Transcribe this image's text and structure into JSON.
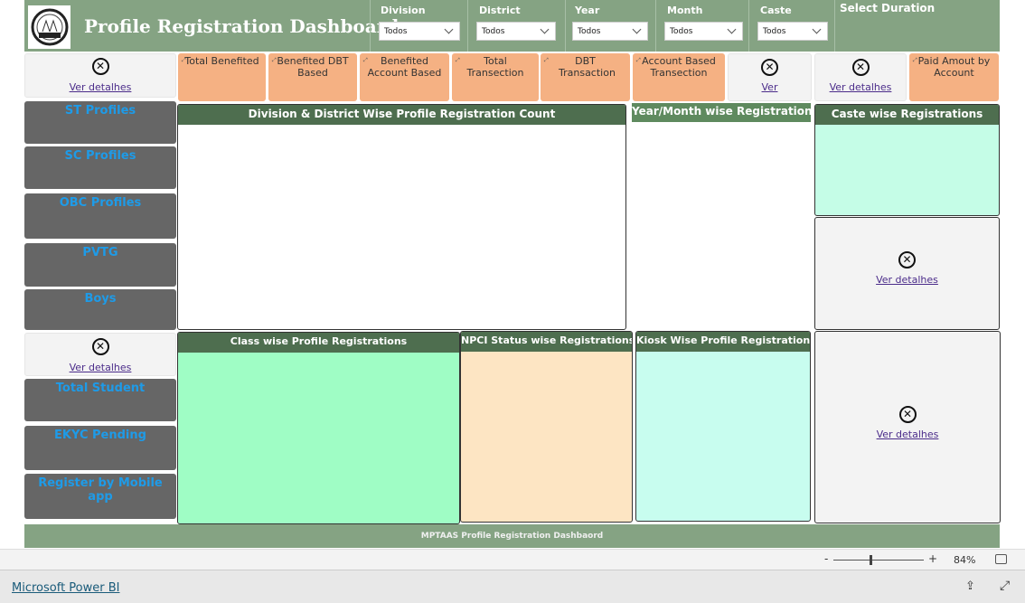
{
  "header": {
    "title": "Profile Registration Dashboard",
    "logo_text": "MPTAAS",
    "select_duration": "Select Duration"
  },
  "filters": [
    {
      "label": "Division",
      "value": "Todos"
    },
    {
      "label": "District",
      "value": "Todos"
    },
    {
      "label": "Year",
      "value": "Todos"
    },
    {
      "label": "Month",
      "value": "Todos"
    },
    {
      "label": "Caste",
      "value": "Todos"
    }
  ],
  "kpis": [
    "Total Benefited",
    "Benefited DBT Based",
    "Benefited Account Based",
    "Total Transection",
    "DBT Transaction",
    "Account Based Transection",
    "Paid Amout by Account"
  ],
  "details_link": "Ver detalhes",
  "details_link_short": "Ver",
  "sidebar": [
    "ST Profiles",
    "SC Profiles",
    "OBC Profiles",
    "PVTG",
    "Boys",
    "Total Student",
    "EKYC Pending",
    "Register by Mobile app"
  ],
  "panels": {
    "division": "Division & District  Wise Profile Registration Count",
    "yearmonth": "Year/Month wise Registration",
    "caste": "Caste wise Registrations",
    "class": "Class wise Profile Registrations",
    "npci": "NPCI Status wise Registrations",
    "kiosk": "Kiosk Wise Profile Registrations"
  },
  "footer": "MPTAAS Profile Registration Dashbaord",
  "zoom": {
    "level": "84%",
    "minus": "-",
    "plus": "+"
  },
  "app": {
    "link": "Microsoft Power BI"
  },
  "colors": {
    "header": "#85a383",
    "panel_header": "#4e6e4f",
    "kpi": "#f5b183",
    "sidebar_tile": "#666666",
    "sidebar_text": "#1e9be8",
    "caste_body": "#c5fde7",
    "class_body": "#9ffdc5",
    "npci_body": "#fde5c3",
    "kiosk_body": "#c8fdef"
  }
}
